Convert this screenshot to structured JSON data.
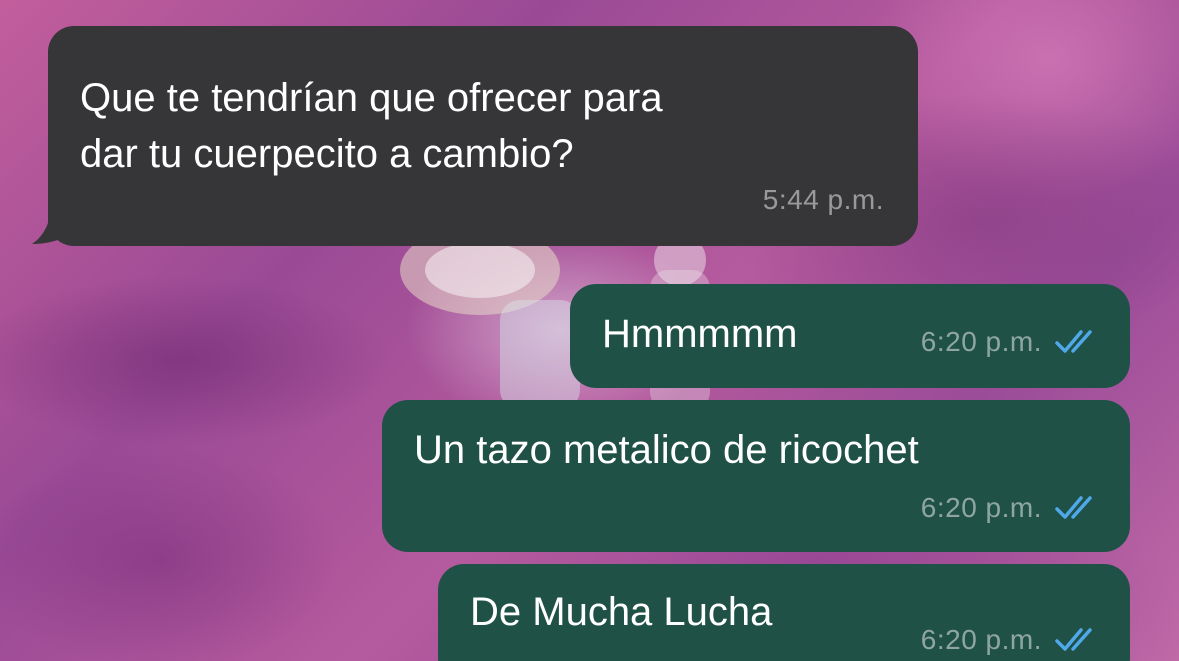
{
  "messages": [
    {
      "direction": "incoming",
      "text": "Que te tendrían que ofrecer para\ndar tu cuerpecito a cambio?",
      "time": "5:44 p.m."
    },
    {
      "direction": "outgoing",
      "text": "Hmmmmm",
      "time": "6:20 p.m.",
      "status_icon": "double-check-read-icon"
    },
    {
      "direction": "outgoing",
      "text": "Un tazo metalico de ricochet",
      "time": "6:20 p.m.",
      "status_icon": "double-check-read-icon"
    },
    {
      "direction": "outgoing",
      "text": "De Mucha Lucha",
      "time": "6:20 p.m.",
      "status_icon": "double-check-read-icon"
    }
  ],
  "colors": {
    "incoming_bubble": "#363638",
    "outgoing_bubble": "#1f5147",
    "read_ticks": "#4fa8e8"
  }
}
